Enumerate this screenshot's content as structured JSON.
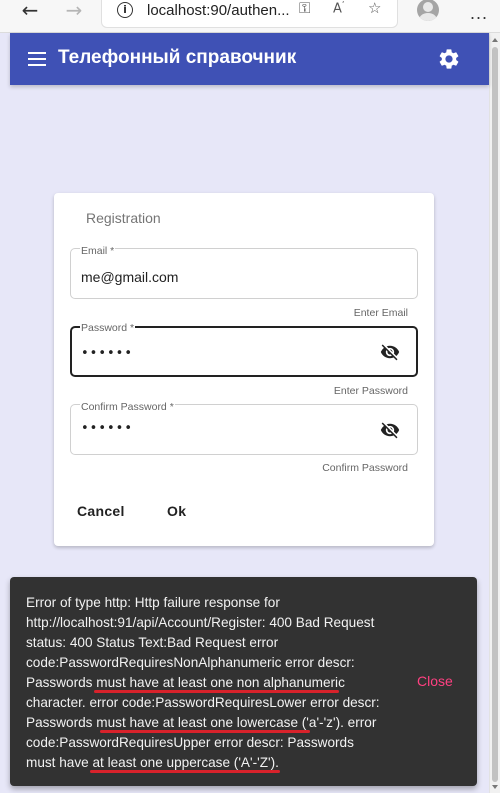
{
  "browser": {
    "back_icon": "back-arrow-icon",
    "forward_icon": "forward-arrow-icon",
    "url": "localhost:90/authen...",
    "more_label": "...",
    "accent": "#3f51b5"
  },
  "toolbar": {
    "title": "Телефонный справочник",
    "menu_icon": "hamburger-menu-icon",
    "settings_icon": "gear-icon",
    "background": "#3f51b5"
  },
  "form": {
    "title": "Registration",
    "email": {
      "label": "Email *",
      "value": "me@gmail.com",
      "hint": "Enter Email"
    },
    "password": {
      "label": "Password *",
      "value": "••••••",
      "hint": "Enter Password"
    },
    "confirm_password": {
      "label": "Confirm Password *",
      "value": "••••••",
      "hint": "Confirm Password"
    },
    "cancel_label": "Cancel",
    "ok_label": "Ok"
  },
  "snackbar": {
    "lines": [
      "Error of type http: Http failure response for",
      "http://localhost:91/api/Account/Register: 400 Bad Request",
      "status: 400 Status Text:Bad Request error",
      "code:PasswordRequiresNonAlphanumeric error descr:",
      "Passwords must have at least one non alphanumeric",
      "character. error code:PasswordRequiresLower error descr:",
      "Passwords must have at least one lowercase ('a'-'z'). error",
      "code:PasswordRequiresUpper error descr: Passwords",
      "must have at least one uppercase ('A'-'Z')."
    ],
    "close_label": "Close",
    "close_color": "#ff4081",
    "underline_color": "#d8222b"
  }
}
